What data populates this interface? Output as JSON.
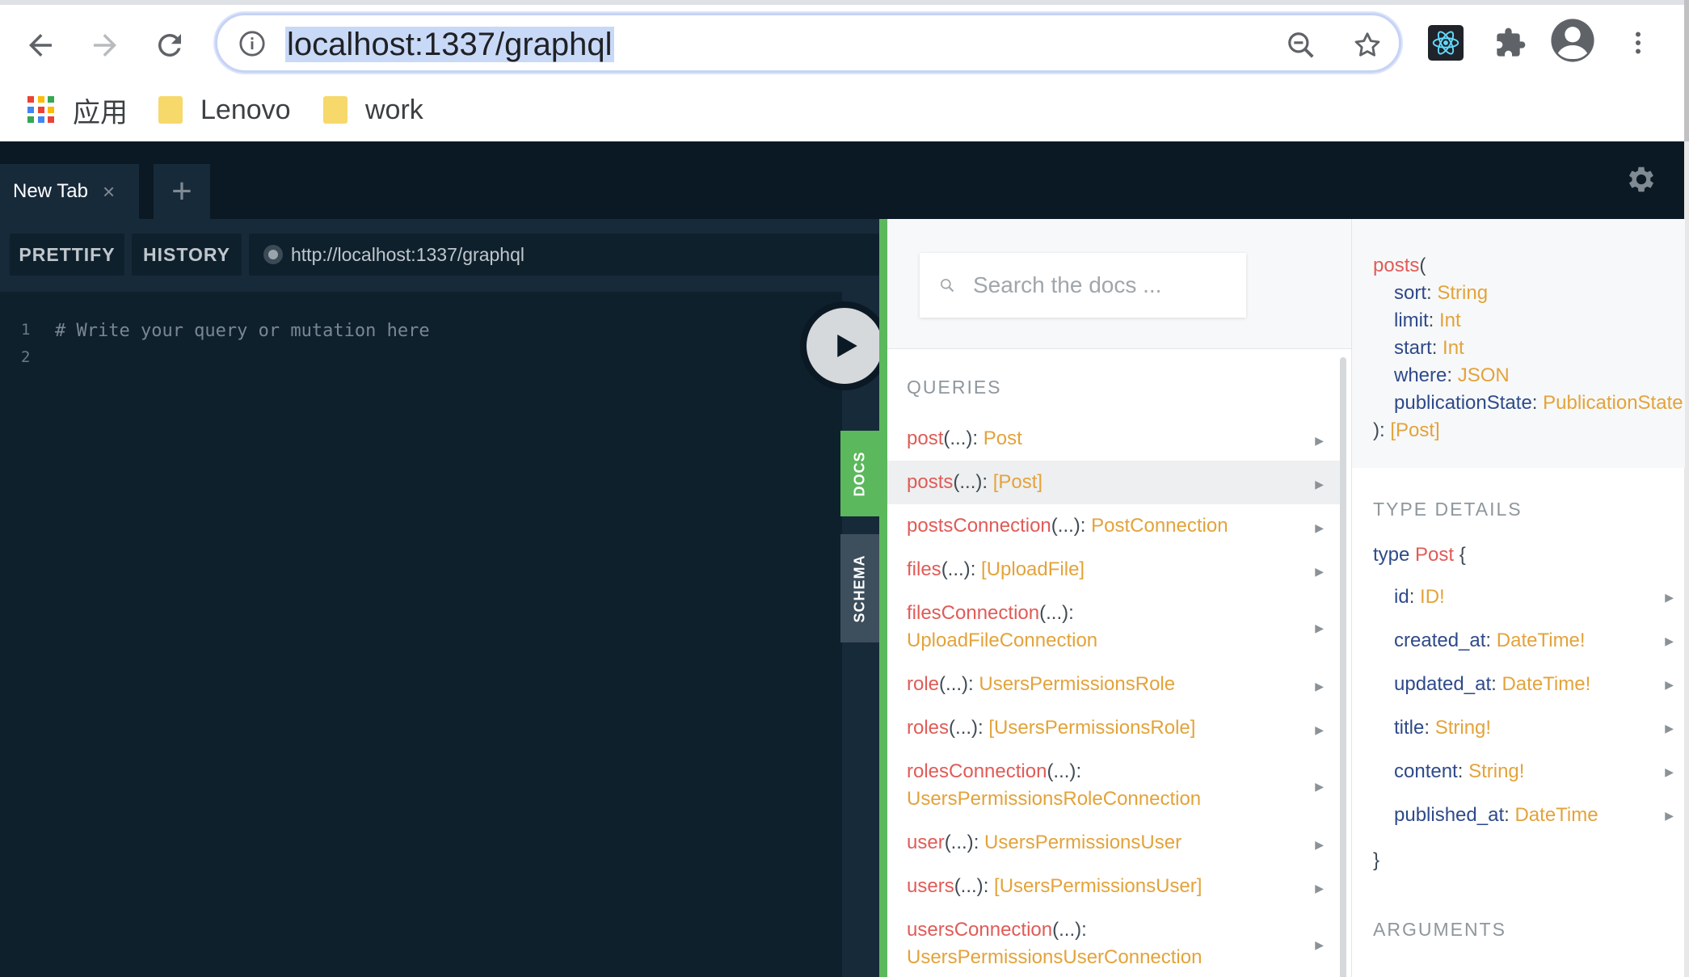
{
  "browser": {
    "url": "localhost:1337/graphql",
    "bookmarks": [
      {
        "label": "应用"
      },
      {
        "label": "Lenovo"
      },
      {
        "label": "work"
      }
    ]
  },
  "playground": {
    "tab": {
      "label": "New Tab",
      "close": "×"
    },
    "add_tab": "+",
    "toolbar": {
      "prettify": "PRETTIFY",
      "history": "HISTORY",
      "endpoint": "http://localhost:1337/graphql"
    },
    "editor": {
      "lines": [
        {
          "no": "1",
          "text": "# Write your query or mutation here"
        },
        {
          "no": "2",
          "text": ""
        }
      ]
    },
    "side_tabs": {
      "docs": "DOCS",
      "schema": "SCHEMA"
    },
    "colors": {
      "accent_green": "#5cb85c",
      "field_red": "#e05b57",
      "type_orange": "#e3a33a",
      "arg_blue": "#2e4a8a",
      "bg_dark": "#0f202d"
    }
  },
  "docs": {
    "search_placeholder": "Search the docs ...",
    "queries_title": "QUERIES",
    "queries": [
      {
        "name": "post",
        "args": "(...)",
        "type": "Post",
        "type2": ""
      },
      {
        "name": "posts",
        "args": "(...)",
        "type": "[Post]",
        "type2": ""
      },
      {
        "name": "postsConnection",
        "args": "(...)",
        "type": "PostConnection",
        "type2": ""
      },
      {
        "name": "files",
        "args": "(...)",
        "type": "[UploadFile]",
        "type2": ""
      },
      {
        "name": "filesConnection",
        "args": "(...)",
        "type": "",
        "type2": "UploadFileConnection"
      },
      {
        "name": "role",
        "args": "(...)",
        "type": "UsersPermissionsRole",
        "type2": ""
      },
      {
        "name": "roles",
        "args": "(...)",
        "type": "[UsersPermissionsRole]",
        "type2": ""
      },
      {
        "name": "rolesConnection",
        "args": "(...)",
        "type": "",
        "type2": "UsersPermissionsRoleConnection"
      },
      {
        "name": "user",
        "args": "(...)",
        "type": "UsersPermissionsUser",
        "type2": ""
      },
      {
        "name": "users",
        "args": "(...)",
        "type": "[UsersPermissionsUser]",
        "type2": ""
      },
      {
        "name": "usersConnection",
        "args": "(...)",
        "type": "",
        "type2": "UsersPermissionsUserConnection"
      }
    ],
    "detail": {
      "name": "posts",
      "open_paren": "(",
      "args": [
        {
          "name": "sort",
          "type": "String"
        },
        {
          "name": "limit",
          "type": "Int"
        },
        {
          "name": "start",
          "type": "Int"
        },
        {
          "name": "where",
          "type": "JSON"
        },
        {
          "name": "publicationState",
          "type": "PublicationState"
        }
      ],
      "close_paren": "):",
      "return_type": "[Post]",
      "type_details_title": "TYPE DETAILS",
      "type_keyword": "type",
      "type_name": "Post",
      "open_brace": "{",
      "fields": [
        {
          "name": "id",
          "type": "ID!"
        },
        {
          "name": "created_at",
          "type": "DateTime!"
        },
        {
          "name": "updated_at",
          "type": "DateTime!"
        },
        {
          "name": "title",
          "type": "String!"
        },
        {
          "name": "content",
          "type": "String!"
        },
        {
          "name": "published_at",
          "type": "DateTime"
        }
      ],
      "close_brace": "}",
      "arguments_title": "ARGUMENTS"
    }
  }
}
